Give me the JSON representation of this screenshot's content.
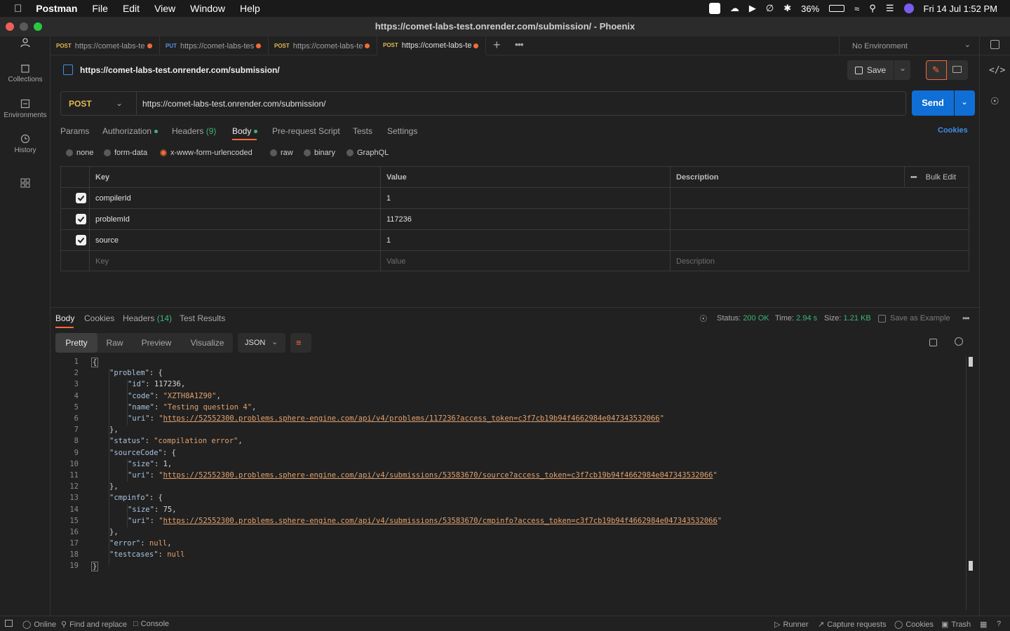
{
  "menubar": {
    "app": "Postman",
    "items": [
      "File",
      "Edit",
      "View",
      "Window",
      "Help"
    ],
    "battery": "36%",
    "datetime": "Fri 14 Jul  1:52 PM"
  },
  "window": {
    "title": "https://comet-labs-test.onrender.com/submission/ - Phoenix"
  },
  "rail": {
    "collections": "Collections",
    "environments": "Environments",
    "history": "History"
  },
  "tabs": [
    {
      "method": "POST",
      "label": "https://comet-labs-te",
      "method_color": "#e0b950"
    },
    {
      "method": "PUT",
      "label": "https://comet-labs-tes",
      "method_color": "#5d8fe0"
    },
    {
      "method": "POST",
      "label": "https://comet-labs-te",
      "method_color": "#e0b950"
    },
    {
      "method": "POST",
      "label": "https://comet-labs-te",
      "method_color": "#e0b950"
    }
  ],
  "environment": "No Environment",
  "request": {
    "name": "https://comet-labs-test.onrender.com/submission/",
    "method": "POST",
    "url": "https://comet-labs-test.onrender.com/submission/",
    "save_label": "Save",
    "send_label": "Send"
  },
  "request_tabs": {
    "params": "Params",
    "authorization": "Authorization",
    "headers": "Headers",
    "headers_count": "(9)",
    "body": "Body",
    "prerequest": "Pre-request Script",
    "tests": "Tests",
    "settings": "Settings",
    "cookies": "Cookies"
  },
  "body_types": {
    "none": "none",
    "form_data": "form-data",
    "urlencoded": "x-www-form-urlencoded",
    "raw": "raw",
    "binary": "binary",
    "graphql": "GraphQL"
  },
  "params_table": {
    "headers": {
      "key": "Key",
      "value": "Value",
      "description": "Description",
      "bulk": "Bulk Edit"
    },
    "rows": [
      {
        "key": "compilerId",
        "value": "1"
      },
      {
        "key": "problemId",
        "value": "117236"
      },
      {
        "key": "source",
        "value": "1"
      }
    ],
    "placeholder": {
      "key": "Key",
      "value": "Value",
      "description": "Description"
    }
  },
  "response_tabs": {
    "body": "Body",
    "cookies": "Cookies",
    "headers": "Headers",
    "headers_count": "(14)",
    "test_results": "Test Results"
  },
  "response_meta": {
    "status_label": "Status:",
    "status": "200 OK",
    "time_label": "Time:",
    "time": "2.94 s",
    "size_label": "Size:",
    "size": "1.21 KB",
    "save_example": "Save as Example"
  },
  "view_modes": {
    "pretty": "Pretty",
    "raw": "Raw",
    "preview": "Preview",
    "visualize": "Visualize",
    "format": "JSON"
  },
  "code": {
    "l1": "{",
    "problem_key": "\"problem\"",
    "id_key": "\"id\"",
    "id_val": "117236",
    "code_key": "\"code\"",
    "code_val": "\"XZTH8A1Z90\"",
    "name_key": "\"name\"",
    "name_val": "\"Testing question 4\"",
    "uri_key": "\"uri\"",
    "uri1": "https://52552300.problems.sphere-engine.com/api/v4/problems/117236?access_token=c3f7cb19b94f4662984e047343532066",
    "status_key": "\"status\"",
    "status_val": "\"compilation error\"",
    "source_key": "\"sourceCode\"",
    "size_key": "\"size\"",
    "size1": "1",
    "uri2": "https://52552300.problems.sphere-engine.com/api/v4/submissions/53583670/source?access_token=c3f7cb19b94f4662984e047343532066",
    "cmp_key": "\"cmpinfo\"",
    "size2": "75",
    "uri3": "https://52552300.problems.sphere-engine.com/api/v4/submissions/53583670/cmpinfo?access_token=c3f7cb19b94f4662984e047343532066",
    "error_key": "\"error\"",
    "null_val": "null",
    "testcases_key": "\"testcases\"",
    "l19": "}"
  },
  "footer": {
    "online": "Online",
    "find": "Find and replace",
    "console": "Console",
    "runner": "Runner",
    "capture": "Capture requests",
    "cookies": "Cookies",
    "trash": "Trash"
  }
}
